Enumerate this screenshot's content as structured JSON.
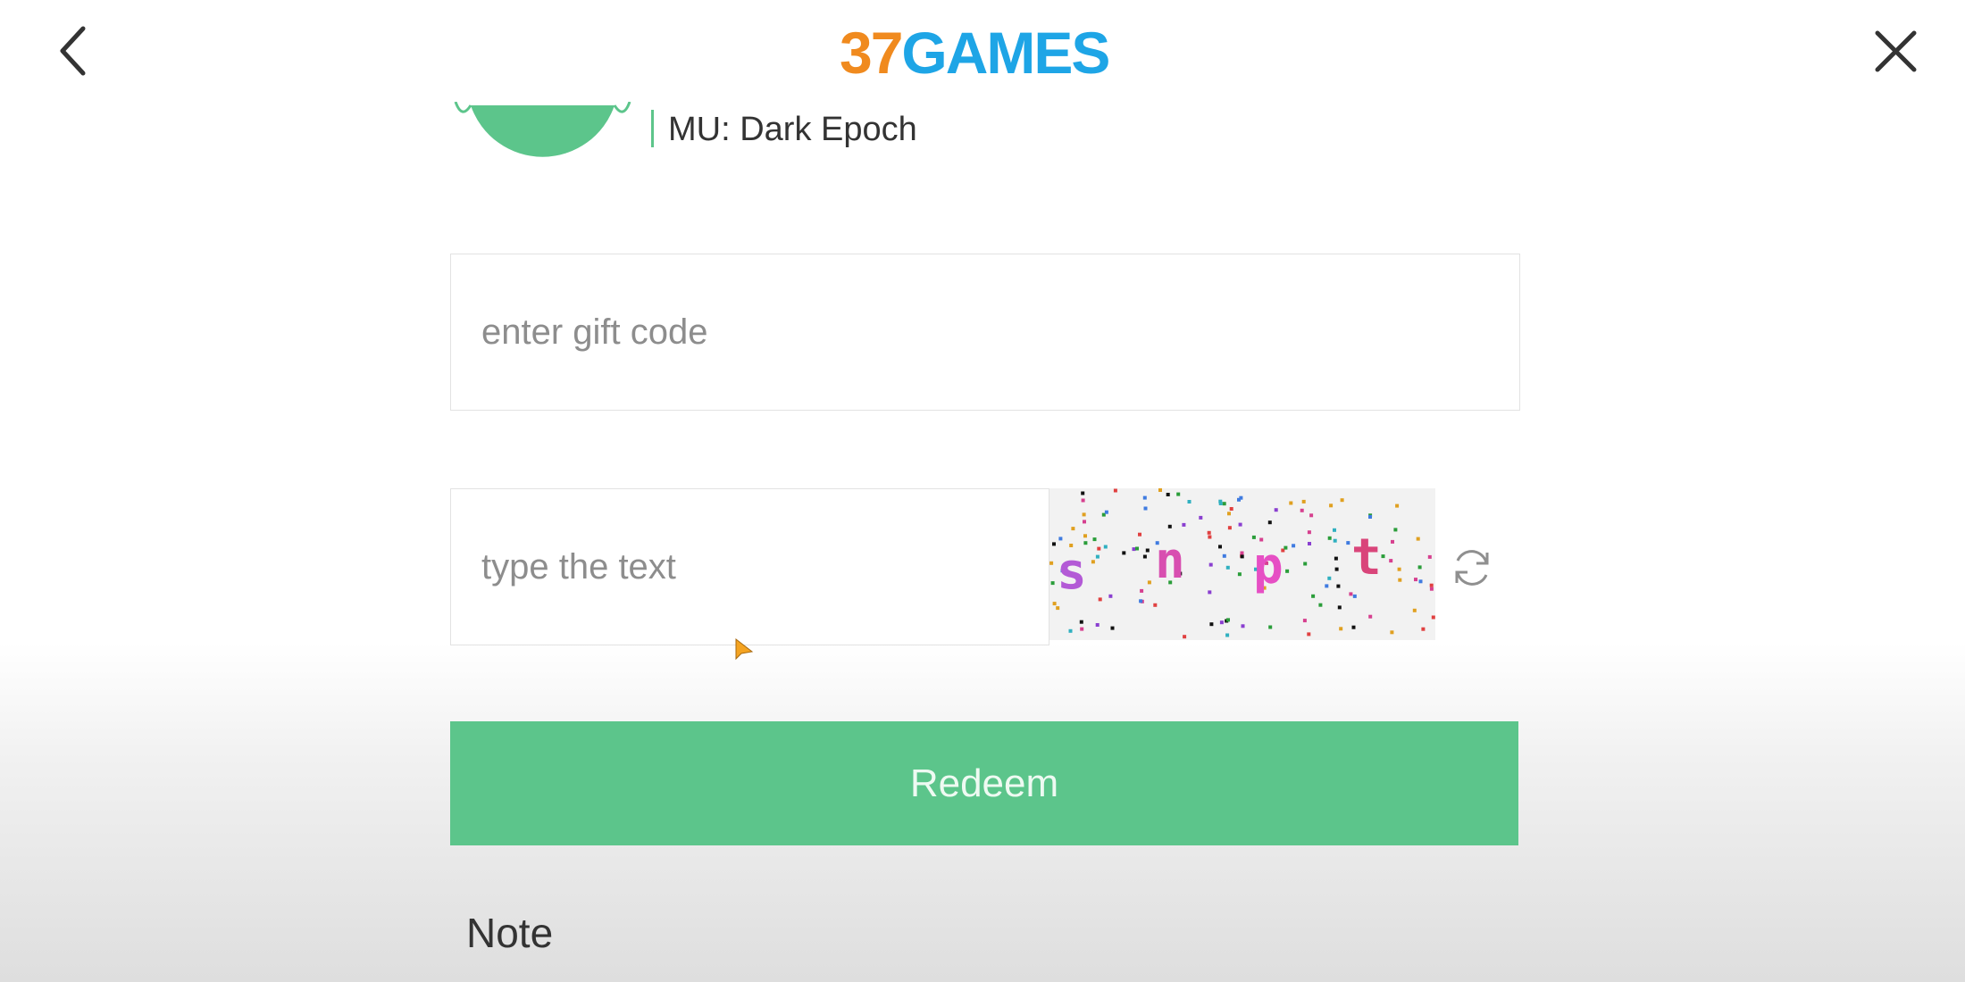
{
  "header": {
    "logo_number": "37",
    "logo_word": "GAMES",
    "back_icon": "chevron-left-icon",
    "close_icon": "close-icon"
  },
  "game": {
    "title": "MU: Dark Epoch",
    "avatar_icon": "game-avatar-icon"
  },
  "form": {
    "gift_code_placeholder": "enter gift code",
    "gift_code_value": "",
    "captcha_placeholder": "type the text",
    "captcha_value": "",
    "captcha_chars": [
      "s",
      "n",
      "p",
      "t"
    ],
    "refresh_icon": "refresh-icon",
    "redeem_label": "Redeem"
  },
  "note": {
    "label": "Note"
  },
  "colors": {
    "accent_green": "#5cc58b",
    "logo_orange": "#f08a1e",
    "logo_blue": "#1ea5e6",
    "captcha_s": "#b35ad6",
    "captcha_n": "#d84fb0",
    "captcha_p": "#e64fc4",
    "captcha_t": "#d9457a"
  }
}
